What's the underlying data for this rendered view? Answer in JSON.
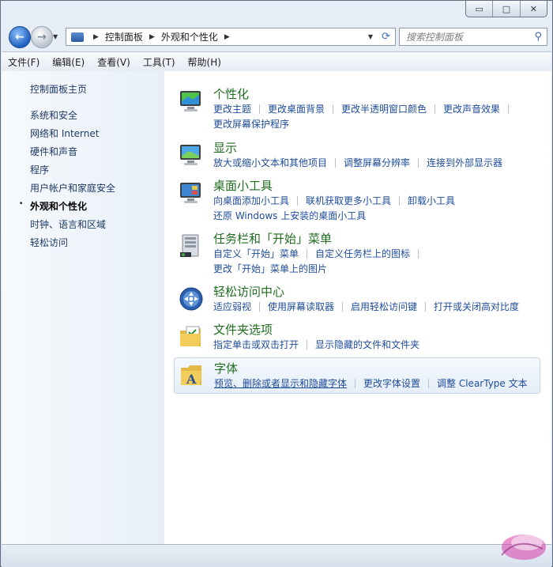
{
  "window": {
    "controls": [
      "▭",
      "□",
      "✕"
    ]
  },
  "nav": {
    "breadcrumbs": [
      "控制面板",
      "外观和个性化"
    ],
    "search_placeholder": "搜索控制面板"
  },
  "menu": [
    "文件(F)",
    "编辑(E)",
    "查看(V)",
    "工具(T)",
    "帮助(H)"
  ],
  "sidebar": {
    "home": "控制面板主页",
    "items": [
      {
        "label": "系统和安全",
        "current": false
      },
      {
        "label": "网络和 Internet",
        "current": false
      },
      {
        "label": "硬件和声音",
        "current": false
      },
      {
        "label": "程序",
        "current": false
      },
      {
        "label": "用户帐户和家庭安全",
        "current": false
      },
      {
        "label": "外观和个性化",
        "current": true
      },
      {
        "label": "时钟、语言和区域",
        "current": false
      },
      {
        "label": "轻松访问",
        "current": false
      }
    ],
    "bullet": "•"
  },
  "categories": [
    {
      "title": "个性化",
      "icon": "personalization-icon",
      "rows": [
        [
          "更改主题",
          "更改桌面背景",
          "更改半透明窗口颜色",
          "更改声音效果"
        ],
        [
          "更改屏幕保护程序"
        ]
      ]
    },
    {
      "title": "显示",
      "icon": "display-icon",
      "rows": [
        [
          "放大或缩小文本和其他项目",
          "调整屏幕分辨率",
          "连接到外部显示器"
        ]
      ]
    },
    {
      "title": "桌面小工具",
      "icon": "gadgets-icon",
      "rows": [
        [
          "向桌面添加小工具",
          "联机获取更多小工具",
          "卸载小工具"
        ],
        [
          "还原 Windows 上安装的桌面小工具"
        ]
      ]
    },
    {
      "title": "任务栏和「开始」菜单",
      "icon": "taskbar-icon",
      "rows": [
        [
          "自定义「开始」菜单",
          "自定义任务栏上的图标"
        ],
        [
          "更改「开始」菜单上的图片"
        ]
      ]
    },
    {
      "title": "轻松访问中心",
      "icon": "ease-of-access-icon",
      "rows": [
        [
          "适应弱视",
          "使用屏幕读取器",
          "启用轻松访问键",
          "打开或关闭高对比度"
        ]
      ]
    },
    {
      "title": "文件夹选项",
      "icon": "folder-icon",
      "rows": [
        [
          "指定单击或双击打开",
          "显示隐藏的文件和文件夹"
        ]
      ]
    },
    {
      "title": "字体",
      "icon": "fonts-icon",
      "rows": [
        [
          "预览、删除或者显示和隐藏字体",
          "更改字体设置",
          "调整 ClearType 文本"
        ]
      ]
    }
  ]
}
